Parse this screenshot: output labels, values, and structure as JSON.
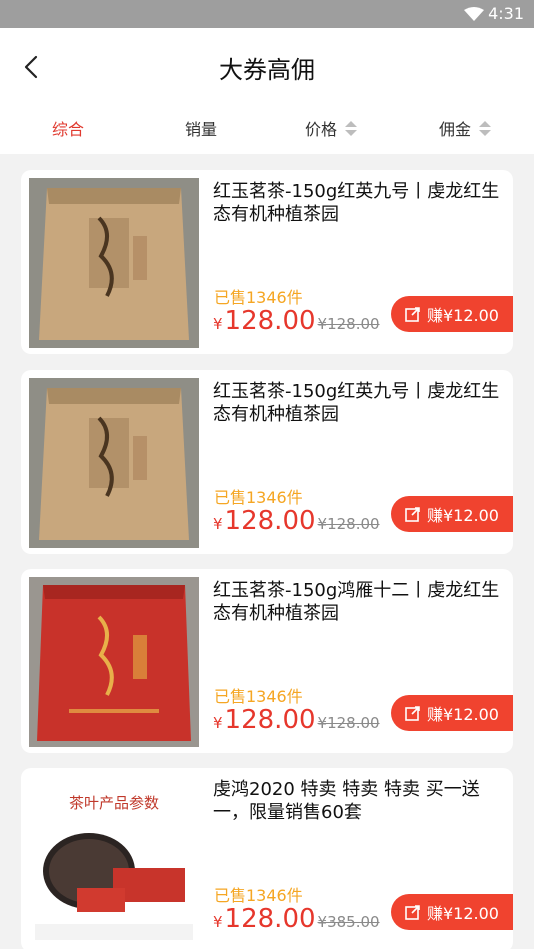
{
  "status": {
    "time": "4:31"
  },
  "header": {
    "title": "大券高佣"
  },
  "sort": {
    "items": [
      {
        "label": "综合"
      },
      {
        "label": "销量"
      },
      {
        "label": "价格"
      },
      {
        "label": "佣金"
      }
    ]
  },
  "products": [
    {
      "title": "红玉茗茶-150g红英九号丨虔龙红生态有机种植茶园",
      "sold": "已售1346件",
      "currency": "¥",
      "price": "128.00",
      "original": "¥128.00",
      "earn": "赚¥12.00",
      "image": "gold-tea-bag"
    },
    {
      "title": "红玉茗茶-150g红英九号丨虔龙红生态有机种植茶园",
      "sold": "已售1346件",
      "currency": "¥",
      "price": "128.00",
      "original": "¥128.00",
      "earn": "赚¥12.00",
      "image": "gold-tea-bag"
    },
    {
      "title": "红玉茗茶-150g鸿雁十二丨虔龙红生态有机种植茶园",
      "sold": "已售1346件",
      "currency": "¥",
      "price": "128.00",
      "original": "¥128.00",
      "earn": "赚¥12.00",
      "image": "red-tea-bag"
    },
    {
      "title": "虔鸿2020 特卖 特卖 特卖 买一送一，限量销售60套",
      "sold": "已售1346件",
      "currency": "¥",
      "price": "128.00",
      "original": "¥385.00",
      "earn": "赚¥12.00",
      "image": "tea-product-params",
      "image_caption": "茶叶产品参数"
    }
  ],
  "colors": {
    "accent": "#e03a2f",
    "sold": "#f5a623",
    "earn_button": "#f0432f",
    "statusbar": "#9e9e9e"
  }
}
